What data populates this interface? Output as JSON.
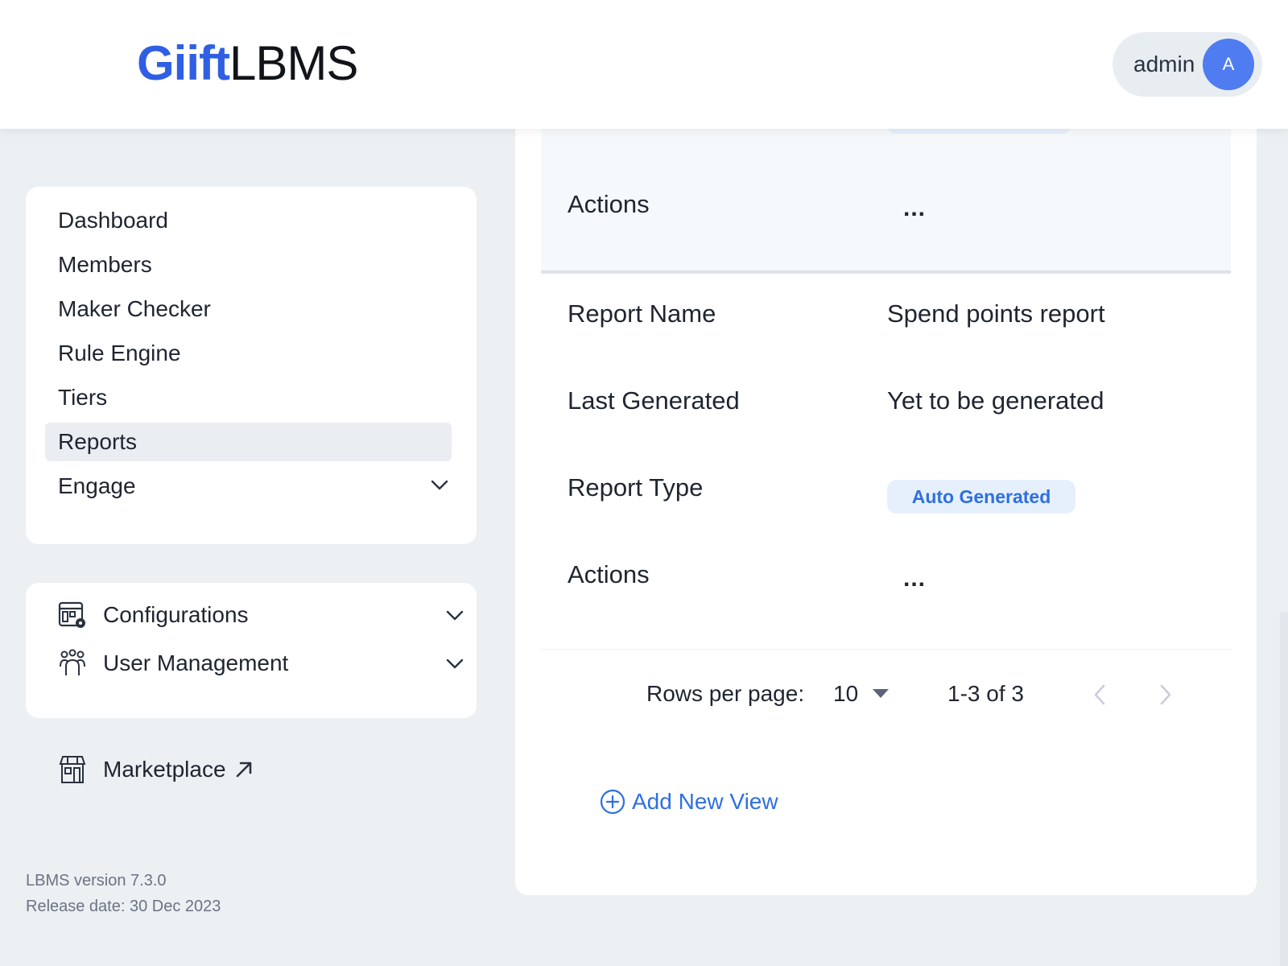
{
  "header": {
    "logo_part1": "Giift",
    "logo_part2": "LBMS",
    "user_name": "admin",
    "avatar_initial": "A"
  },
  "sidebar": {
    "items": [
      {
        "label": "Dashboard"
      },
      {
        "label": "Members"
      },
      {
        "label": "Maker Checker"
      },
      {
        "label": "Rule Engine"
      },
      {
        "label": "Tiers"
      },
      {
        "label": "Reports",
        "active": true
      },
      {
        "label": "Engage",
        "expandable": true
      }
    ],
    "config_items": [
      {
        "label": "Configurations",
        "icon": "configurations-icon"
      },
      {
        "label": "User Management",
        "icon": "user-management-icon"
      }
    ],
    "marketplace": {
      "label": "Marketplace",
      "icon": "marketplace-icon"
    },
    "version": "LBMS version 7.3.0",
    "release_date": "Release date: 30 Dec 2023"
  },
  "report_card": {
    "prev_row": {
      "actions_label": "Actions",
      "actions_value": "..."
    },
    "row": {
      "report_name_label": "Report Name",
      "report_name_value": "Spend points report",
      "last_generated_label": "Last Generated",
      "last_generated_value": "Yet to be generated",
      "report_type_label": "Report Type",
      "report_type_value": "Auto Generated",
      "actions_label": "Actions",
      "actions_value": "..."
    },
    "pagination": {
      "rows_per_page_label": "Rows per page:",
      "rows_per_page_value": "10",
      "range": "1-3 of 3"
    },
    "add_new_view": "Add New View"
  },
  "colors": {
    "accent": "#2f6fe0",
    "logo_blue": "#2f5fe3",
    "avatar_bg": "#4f7cf0",
    "badge_bg": "#e6f0fd",
    "page_bg": "#ecf0f3"
  }
}
